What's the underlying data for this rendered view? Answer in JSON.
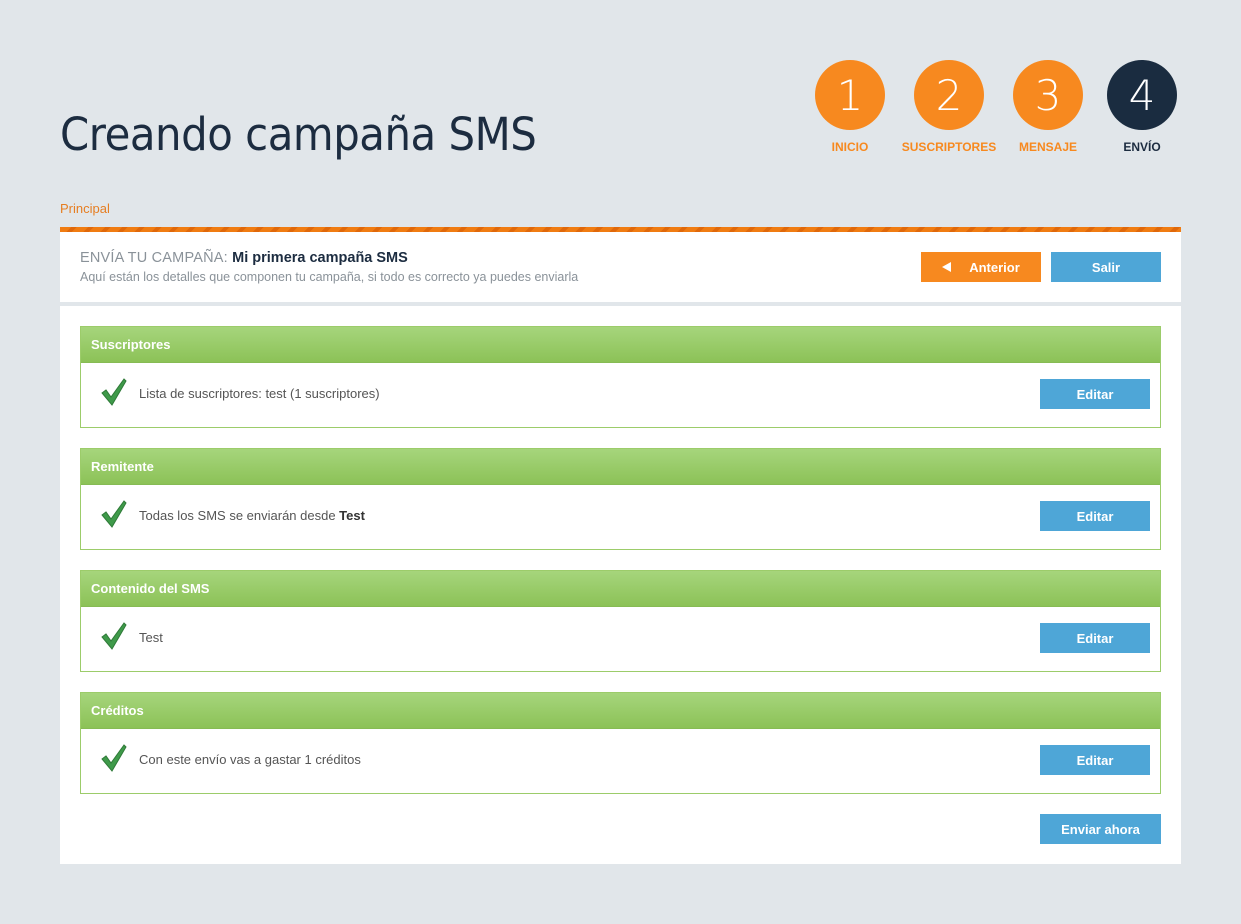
{
  "page": {
    "title": "Creando campaña SMS"
  },
  "steps": [
    {
      "number": "1",
      "label": "INICIO",
      "state": "done"
    },
    {
      "number": "2",
      "label": "SUSCRIPTORES",
      "state": "done"
    },
    {
      "number": "3",
      "label": "MENSAJE",
      "state": "done"
    },
    {
      "number": "4",
      "label": "ENVÍO",
      "state": "active"
    }
  ],
  "breadcrumb": {
    "label": "Principal"
  },
  "header": {
    "prefix": "ENVÍA TU CAMPAÑA:",
    "campaign_name": "Mi primera campaña SMS",
    "subtitle": "Aquí están los detalles que componen tu campaña, si todo es correcto ya puedes enviarla",
    "prev_label": "Anterior",
    "exit_label": "Salir"
  },
  "sections": [
    {
      "title": "Suscriptores",
      "text": "Lista de suscriptores: test (1 suscriptores)",
      "bold": "",
      "edit_label": "Editar"
    },
    {
      "title": "Remitente",
      "text": "Todas los SMS se enviarán desde ",
      "bold": "Test",
      "edit_label": "Editar"
    },
    {
      "title": "Contenido del SMS",
      "text": "Test",
      "bold": "",
      "edit_label": "Editar"
    },
    {
      "title": "Créditos",
      "text": "Con este envío vas a gastar 1 créditos",
      "bold": "",
      "edit_label": "Editar"
    }
  ],
  "footer": {
    "send_label": "Enviar ahora"
  },
  "colors": {
    "accent": "#f7891f",
    "navy": "#1a2c40",
    "button_blue": "#4ea6d7",
    "section_green": "#9ccc6a"
  },
  "icons": {
    "check": "check-icon",
    "prev": "triangle-left-icon"
  }
}
